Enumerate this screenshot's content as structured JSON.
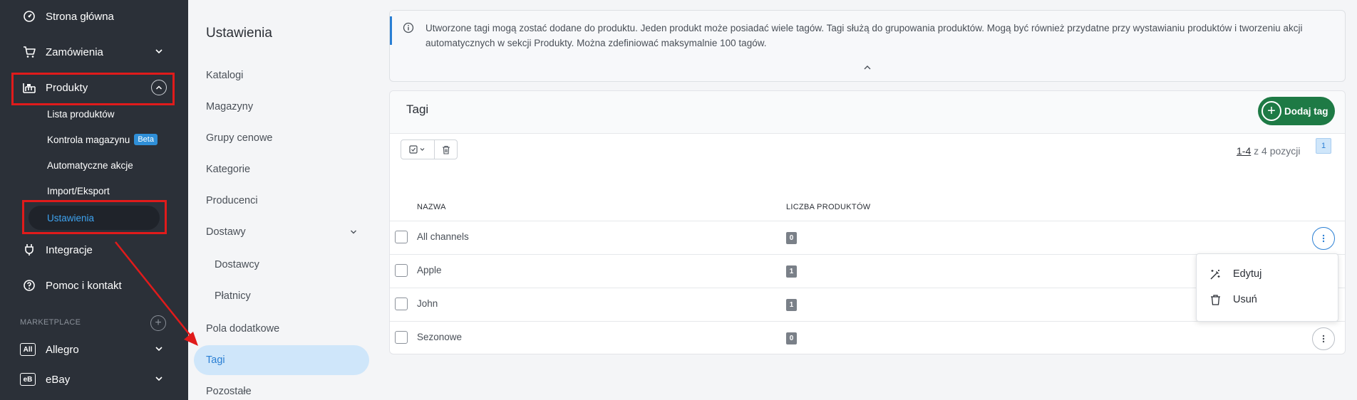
{
  "nav": {
    "home": "Strona główna",
    "orders": "Zamówienia",
    "products": "Produkty",
    "product_sub": {
      "list": "Lista produktów",
      "stock": "Kontrola magazynu",
      "beta": "Beta",
      "auto": "Automatyczne akcje",
      "import": "Import/Eksport",
      "settings": "Ustawienia"
    },
    "integrations": "Integracje",
    "help": "Pomoc i kontakt",
    "marketplace_label": "MARKETPLACE",
    "marketplaces": [
      {
        "badge": "All",
        "name": "Allegro"
      },
      {
        "badge": "eB",
        "name": "eBay"
      }
    ]
  },
  "settings": {
    "title": "Ustawienia",
    "items": {
      "catalogs": "Katalogi",
      "warehouses": "Magazyny",
      "price_groups": "Grupy cenowe",
      "categories": "Kategorie",
      "producers": "Producenci",
      "deliveries": "Dostawy",
      "suppliers": "Dostawcy",
      "payers": "Płatnicy",
      "extra_fields": "Pola dodatkowe",
      "tags": "Tagi",
      "other": "Pozostałe"
    }
  },
  "info": {
    "text": "Utworzone tagi mogą zostać dodane do produktu. Jeden produkt może posiadać wiele tagów. Tagi służą do grupowania produktów. Mogą być również przydatne przy wystawianiu produktów i tworzeniu akcji automatycznych w sekcji Produkty. Można zdefiniować maksymalnie 100 tagów."
  },
  "tags_card": {
    "title": "Tagi",
    "add_label": "Dodaj tag",
    "pager_range": "1-4",
    "pager_rest": " z 4 pozycji",
    "page": "1",
    "columns": {
      "name": "NAZWA",
      "count": "LICZBA PRODUKTÓW"
    },
    "rows": [
      {
        "name": "All channels",
        "count": "0"
      },
      {
        "name": "Apple",
        "count": "1"
      },
      {
        "name": "John",
        "count": "1"
      },
      {
        "name": "Sezonowe",
        "count": "0"
      }
    ]
  },
  "menu": {
    "edit": "Edytuj",
    "delete": "Usuń"
  },
  "colors": {
    "accent": "#2a7fd4",
    "add_button": "#1e7a45",
    "highlight": "#e01b1b",
    "nav_bg": "#2b3038"
  }
}
